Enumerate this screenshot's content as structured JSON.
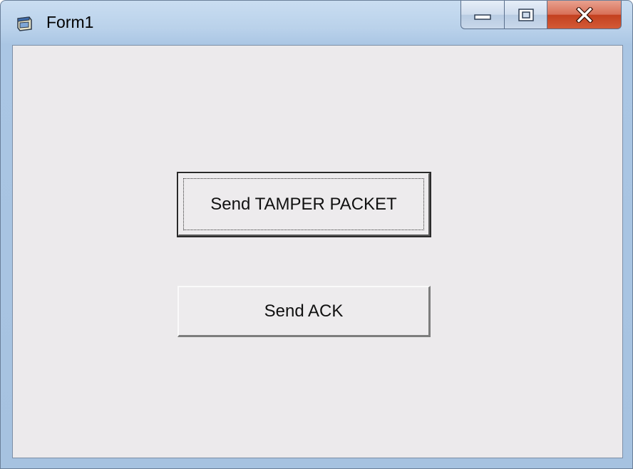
{
  "window": {
    "title": "Form1",
    "icon": "form-window-icon"
  },
  "caption_buttons": {
    "minimize_icon": "minimize-icon",
    "maximize_icon": "maximize-icon",
    "close_icon": "close-icon"
  },
  "form": {
    "tamper_button_label": "Send TAMPER PACKET",
    "ack_button_label": "Send ACK"
  },
  "colors": {
    "form_background": "#eceaec",
    "titlebar": "#b9d1ea",
    "close_button": "#c3401f"
  }
}
